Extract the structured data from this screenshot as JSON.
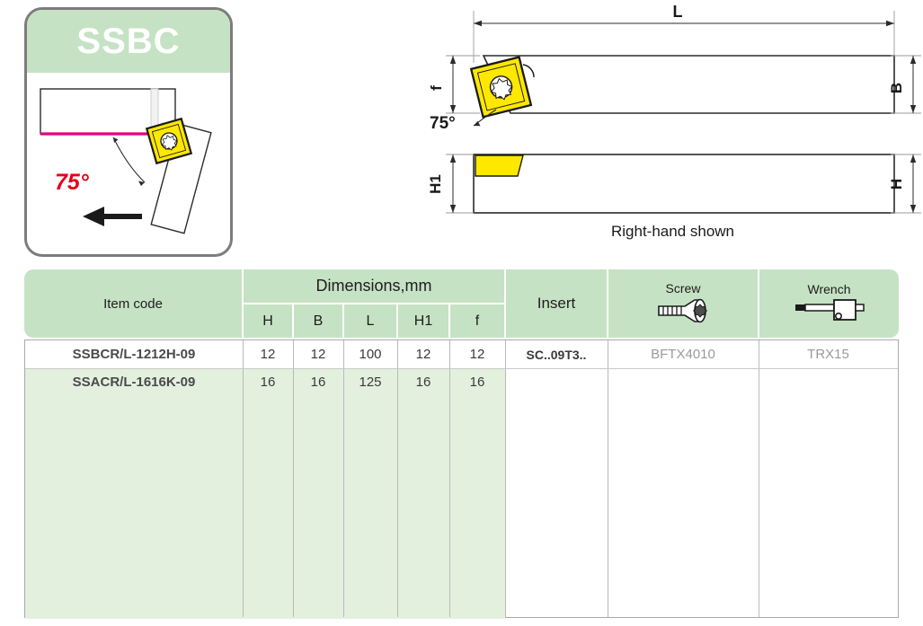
{
  "product_card": {
    "title": "SSBC",
    "angle_label": "75°",
    "diagram_name": "approach-angle-diagram"
  },
  "drawing": {
    "length_label": "L",
    "width_label": "B",
    "face_label": "f",
    "angle_label": "75°",
    "head_height_label": "H1",
    "shank_height_label": "H",
    "caption": "Right-hand shown"
  },
  "table": {
    "headers": {
      "item_code": "Item code",
      "dimensions_group": "Dimensions,mm",
      "dims": [
        "H",
        "B",
        "L",
        "H1",
        "f"
      ],
      "insert": "Insert",
      "screw": "Screw",
      "wrench": "Wrench"
    },
    "rows": [
      {
        "item_code": "SSBCR/L-1212H-09",
        "H": "12",
        "B": "12",
        "L": "100",
        "H1": "12",
        "f": "12",
        "insert": "SC..09T3..",
        "screw": "BFTX4010",
        "wrench": "TRX15"
      },
      {
        "item_code": "SSACR/L-1616K-09",
        "H": "16",
        "B": "16",
        "L": "125",
        "H1": "16",
        "f": "16",
        "insert": "",
        "screw": "",
        "wrench": ""
      }
    ]
  },
  "colors": {
    "header_green": "#c6e2c4",
    "body_green": "#e4f0de",
    "banner_green": "#c6e2c4",
    "insert_yellow": "#ffe800",
    "cut_line_magenta": "#e6007e",
    "angle_red": "#e4001b",
    "card_border": "#7c7c7c"
  }
}
